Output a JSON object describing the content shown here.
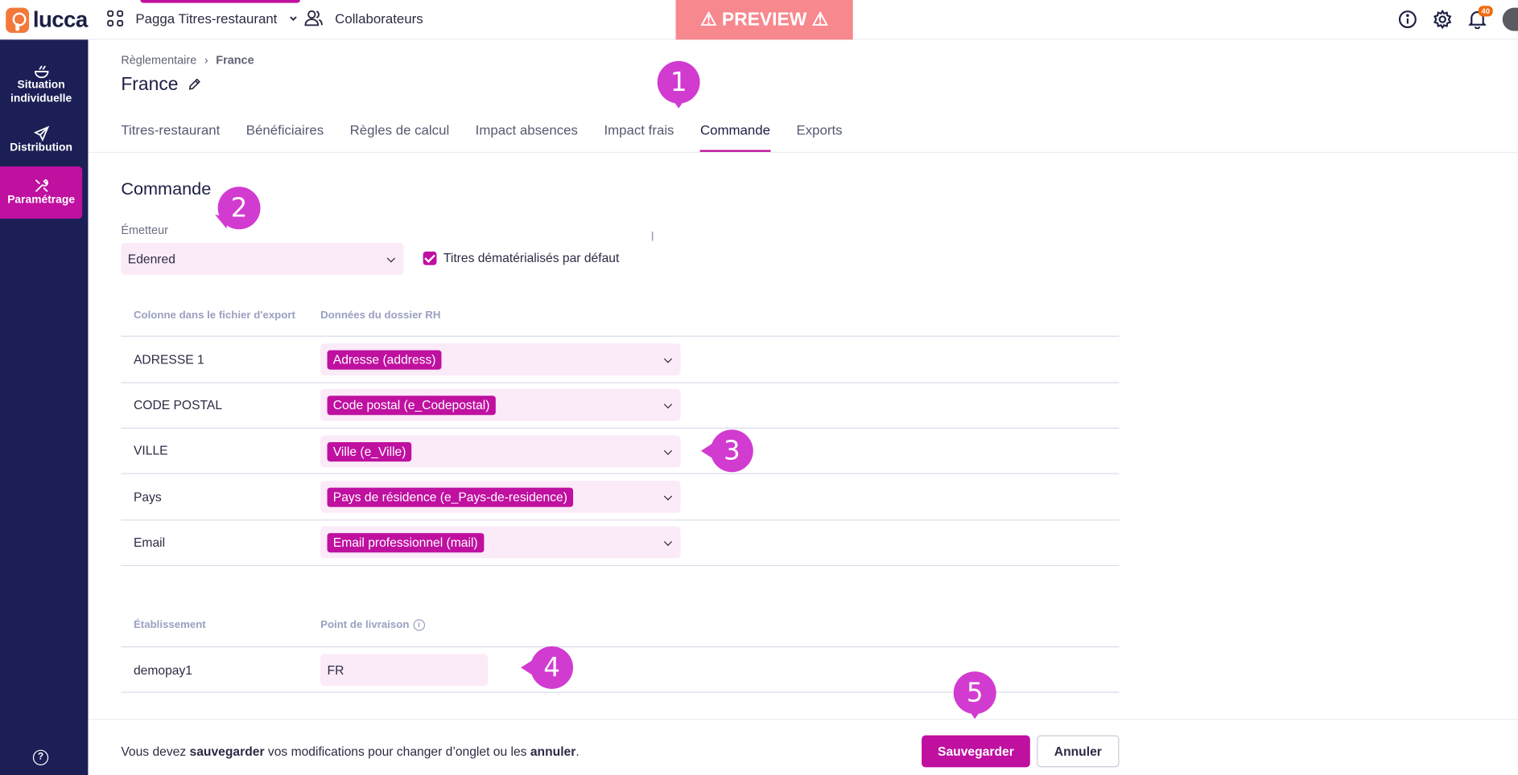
{
  "topbar": {
    "logo": "lucca",
    "app_name": "Pagga Titres-restaurant",
    "collab_label": "Collaborateurs",
    "preview": "⚠ PREVIEW ⚠",
    "notif_count": "40"
  },
  "sidebar": {
    "items": [
      {
        "label1": "Situation",
        "label2": "individuelle",
        "icon": "bowl-icon"
      },
      {
        "label1": "Distribution",
        "label2": "",
        "icon": "paper-plane-icon"
      },
      {
        "label1": "Paramétrage",
        "label2": "",
        "icon": "tools-icon"
      }
    ],
    "help": "?"
  },
  "breadcrumb": {
    "parent": "Règlementaire",
    "current": "France"
  },
  "page_title": "France",
  "tabs": [
    "Titres-restaurant",
    "Bénéficiaires",
    "Règles de calcul",
    "Impact absences",
    "Impact frais",
    "Commande",
    "Exports"
  ],
  "active_tab": "Commande",
  "section": {
    "title": "Commande",
    "emitter_label": "Émetteur",
    "emitter_value": "Edenred",
    "checkbox_label": "Titres dématérialisés par défaut",
    "checkbox_checked": true
  },
  "mapping": {
    "col1_header": "Colonne dans le fichier d'export",
    "col2_header": "Données du dossier RH",
    "rows": [
      {
        "label": "ADRESSE 1",
        "value": "Adresse (address)"
      },
      {
        "label": "CODE POSTAL",
        "value": "Code postal (e_Codepostal)"
      },
      {
        "label": "VILLE",
        "value": "Ville (e_Ville)"
      },
      {
        "label": "Pays",
        "value": "Pays de résidence (e_Pays-de-residence)"
      },
      {
        "label": "Email",
        "value": "Email professionnel (mail)"
      }
    ]
  },
  "delivery": {
    "col1_header": "Établissement",
    "col2_header": "Point de livraison",
    "row_label": "demopay1",
    "row_value": "FR"
  },
  "footer": {
    "msg_1": "Vous devez ",
    "msg_2": "sauvegarder",
    "msg_3": " vos modifications pour changer d’onglet ou les ",
    "msg_4": "annuler",
    "msg_5": ".",
    "save": "Sauvegarder",
    "cancel": "Annuler"
  },
  "markers": [
    "1",
    "2",
    "3",
    "4",
    "5"
  ],
  "colors": {
    "accent": "#bf10a0",
    "sidebar": "#1c1f55",
    "select_bg": "#fbeaf8",
    "marker": "#d23bd0",
    "preview": "#f7888e"
  }
}
